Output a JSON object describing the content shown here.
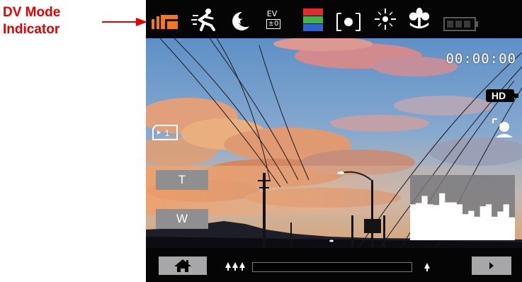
{
  "annotation": {
    "line1": "DV Mode",
    "line2": "Indicator",
    "color": "#e60000"
  },
  "top_bar": {
    "icons": [
      "dv-mode-icon",
      "sports-scene-icon",
      "night-scene-icon",
      "exposure-value-icon",
      "color-effect-icon",
      "spot-metering-icon",
      "white-balance-daylight-icon",
      "macro-icon",
      "battery-icon"
    ],
    "ev_label": "EV",
    "ev_value": "±0"
  },
  "overlay": {
    "timecode": "00:00:00",
    "resolution_label": "HD",
    "zoom_in_label": "T",
    "zoom_out_label": "W",
    "memory_icon": "sd-card-icon",
    "face_icon": "face-detection-icon",
    "histogram_bars": [
      0.55,
      0.57,
      0.68,
      0.55,
      0.54,
      0.72,
      0.58,
      0.58,
      0.55,
      0.4,
      0.45,
      0.36,
      0.52,
      0.55,
      0.36,
      0.44,
      0.55,
      0.35
    ]
  },
  "bottom_bar": {
    "home_icon": "home-icon",
    "zoom_tele_icon": "tele-trees-icon",
    "zoom_wide_icon": "wide-tree-icon",
    "zoom_level": 0,
    "next_icon": "play-next-icon"
  },
  "colors": {
    "accent_orange": "#f07a1a",
    "bar_bg": "#050505",
    "button_gray": "#8f8f91"
  }
}
